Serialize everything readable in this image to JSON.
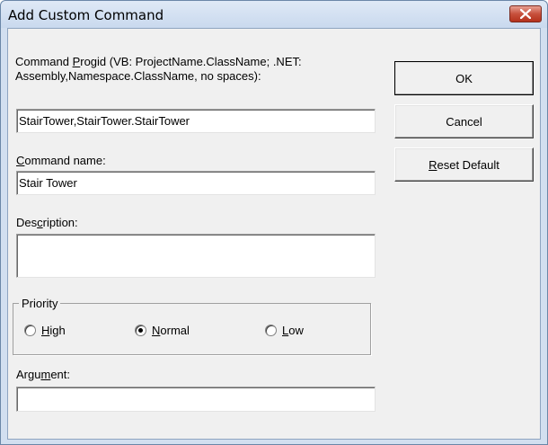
{
  "window": {
    "title": "Add Custom Command"
  },
  "progid": {
    "label_line1_pre": "Command ",
    "label_line1_accel": "P",
    "label_line1_post": "rogid (VB: ProjectName.ClassName; .NET:",
    "label_line2": "Assembly,Namespace.ClassName, no spaces):",
    "value": "StairTower,StairTower.StairTower"
  },
  "command_name": {
    "label_accel": "C",
    "label_post": "ommand name:",
    "value": "Stair Tower"
  },
  "description": {
    "label_pre": "Des",
    "label_accel": "c",
    "label_post": "ription:",
    "value": ""
  },
  "priority": {
    "legend": "Priority",
    "options": [
      {
        "accel": "H",
        "rest": "igh",
        "selected": false
      },
      {
        "accel": "N",
        "rest": "ormal",
        "selected": true
      },
      {
        "accel": "L",
        "rest": "ow",
        "selected": false
      }
    ]
  },
  "argument": {
    "label_pre": "Argu",
    "label_accel": "m",
    "label_post": "ent:",
    "value": ""
  },
  "buttons": {
    "ok": "OK",
    "cancel": "Cancel",
    "reset_accel": "R",
    "reset_rest": "eset Default"
  },
  "colors": {
    "title_bar": "#c9d9ee",
    "close_button": "#c7503c",
    "dialog_face": "#f0f0f0"
  }
}
